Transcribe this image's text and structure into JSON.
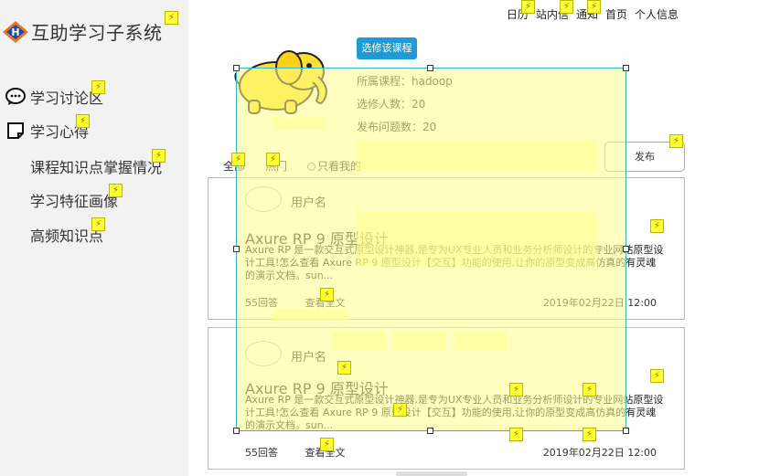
{
  "app": {
    "title": "互助学习子系统"
  },
  "topnav": {
    "items": [
      "日历",
      "站内信",
      "通知",
      "首页",
      "个人信息"
    ]
  },
  "sidebar": {
    "items": [
      {
        "label": "学习讨论区",
        "icon": "chat-bubble-icon"
      },
      {
        "label": "学习心得",
        "icon": "note-icon"
      },
      {
        "label": "课程知识点掌握情况",
        "icon": ""
      },
      {
        "label": "学习特征画像",
        "icon": ""
      },
      {
        "label": "高频知识点",
        "icon": ""
      }
    ]
  },
  "course": {
    "enroll_label": "选修该课程",
    "course_line": "所属课程：hadoop",
    "students_line": "选修人数：20",
    "questions_line": "发布问题数：20",
    "image_icon": "hadoop-elephant-icon"
  },
  "tabs": {
    "all": "全部",
    "hot": "热门",
    "mine": "只看我的",
    "publish": "发布"
  },
  "posts": [
    {
      "username": "用户名",
      "title": "Axure RP 9 原型设计",
      "body": "Axure RP 是一款交互式原型设计神器,是专为UX专业人员和业务分析师设计的专业网站原型设计工具!怎么查看 Axure RP 9 原型设计【交互】功能的使用,让你的原型变成高仿真的有灵魂的演示文档。sun...",
      "answers": "55回答",
      "view_all": "查看全文",
      "date": "2019年02月22日 12:00"
    },
    {
      "username": "用户名",
      "title": "Axure RP 9 原型设计",
      "body": "Axure RP 是一款交互式原型设计神器,是专为UX专业人员和业务分析师设计的专业网站原型设计工具!怎么查看 Axure RP 9 原型设计【交互】功能的使用,让你的原型变成高仿真的有灵魂的演示文档。sun...",
      "answers": "55回答",
      "view_all": "查看全文",
      "date": "2019年02月22日 12:00"
    }
  ],
  "colors": {
    "accent": "#1e9ad6",
    "sidebar_bg": "#f2f2f2",
    "highlight": "#ffff8c",
    "selection": "#2cb8c8",
    "marker": "#ffff33"
  }
}
